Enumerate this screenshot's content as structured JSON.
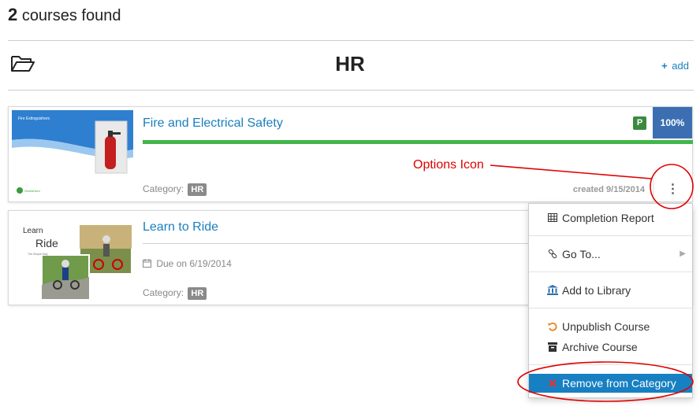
{
  "results": {
    "count": "2",
    "label": "courses found"
  },
  "category": {
    "title": "HR",
    "add_label": "add"
  },
  "courses": [
    {
      "title": "Fire and Electrical Safety",
      "thumb_caption": "Fire Extinguishers",
      "thumb_brand": "GreenHorn",
      "badge": "P",
      "progress": "100%",
      "category_label": "Category:",
      "category_tag": "HR",
      "created": "created 9/15/2014",
      "options_glyph": "⋮"
    },
    {
      "title": "Learn to Ride",
      "thumb_line1": "Learn",
      "thumb_line2": "Ride",
      "thumb_line3": "The Simple Way",
      "due": "Due on 6/19/2014",
      "category_label": "Category:",
      "category_tag": "HR"
    }
  ],
  "annotation": {
    "text": "Options Icon"
  },
  "menu": {
    "items": [
      {
        "label": "Completion Report",
        "icon": "table-icon"
      },
      {
        "label": "Go To...",
        "icon": "link-icon"
      },
      {
        "label": "Add to Library",
        "icon": "bank-icon"
      },
      {
        "label": "Unpublish Course",
        "icon": "undo-icon"
      },
      {
        "label": "Archive Course",
        "icon": "archive-icon"
      },
      {
        "label": "Remove from Category",
        "icon": "remove-icon"
      }
    ]
  },
  "colors": {
    "link": "#1a7fbf",
    "progress": "#43b649",
    "percent_badge": "#3c6fb1",
    "published_badge": "#3b8a3e",
    "menu_active": "#1780c2",
    "annotation": "#e00000"
  }
}
